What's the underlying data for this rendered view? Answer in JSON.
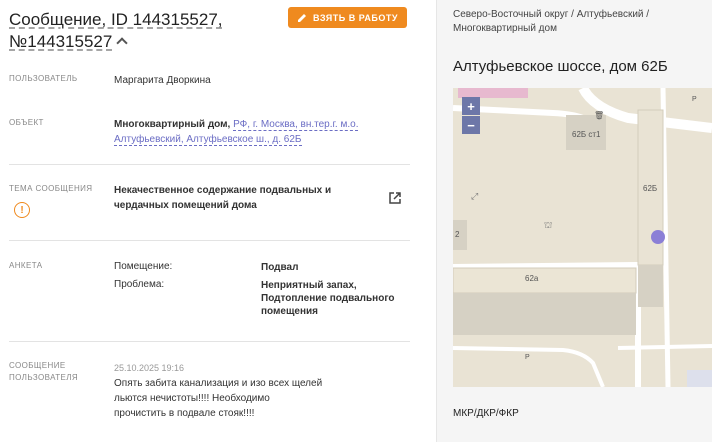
{
  "header": {
    "title_part1": "Сообщение, ID 144315527,",
    "title_part2": "№144315527",
    "take_button": "ВЗЯТЬ В РАБОТУ"
  },
  "fields": {
    "user_label": "ПОЛЬЗОВАТЕЛЬ",
    "user_value": "Маргарита Дворкина",
    "object_label": "ОБЪЕКТ",
    "object_type": "Многоквартирный дом,",
    "object_address_line1": "РФ, г. Москва, вн.тер.г. м.о.",
    "object_address_line2": "Алтуфьевский, Алтуфьевское ш., д. 62Б",
    "topic_label_line1": "ТЕМА СООБЩЕНИЯ",
    "topic_value_line1": "Некачественное содержание подвальных и",
    "topic_value_line2": "чердачных помещений дома",
    "survey_label": "АНКЕТА",
    "survey_rows": [
      {
        "key": "Помещение:",
        "value_lines": [
          "Подвал"
        ]
      },
      {
        "key": "Проблема:",
        "value_lines": [
          "Неприятный запах,",
          "Подтопление подвального",
          "помещения"
        ]
      }
    ],
    "message_label_line1": "СООБЩЕНИЕ",
    "message_label_line2": "ПОЛЬЗОВАТЕЛЯ",
    "message_date": "25.10.2025 19:16",
    "message_lines": [
      "Опять забита канализация и изо всех щелей",
      "льются нечистоты!!!! Необходимо",
      "прочистить в подвале стояк!!!!"
    ]
  },
  "side": {
    "breadcrumb_line1": "Северо-Восточный округ / Алтуфьевский /",
    "breadcrumb_line2": "Многоквартирный дом",
    "address_title": "Алтуфьевское шоссе, дом 62Б",
    "map_labels": {
      "b1": "62Б ст1",
      "b2": "62Б",
      "b3": "62а",
      "b4": "2",
      "p1": "Р",
      "p2": "Р"
    },
    "zoom_in": "+",
    "zoom_out": "−",
    "footer": "МКР/ДКР/ФКР"
  },
  "colors": {
    "accent": "#ef8a1f",
    "link": "#6b6dc4",
    "marker": "#8b7fd6"
  },
  "icons": {
    "pencil": "pencil-icon",
    "chevron": "chevron-up-icon",
    "warning": "warning-icon",
    "external": "external-link-icon"
  }
}
